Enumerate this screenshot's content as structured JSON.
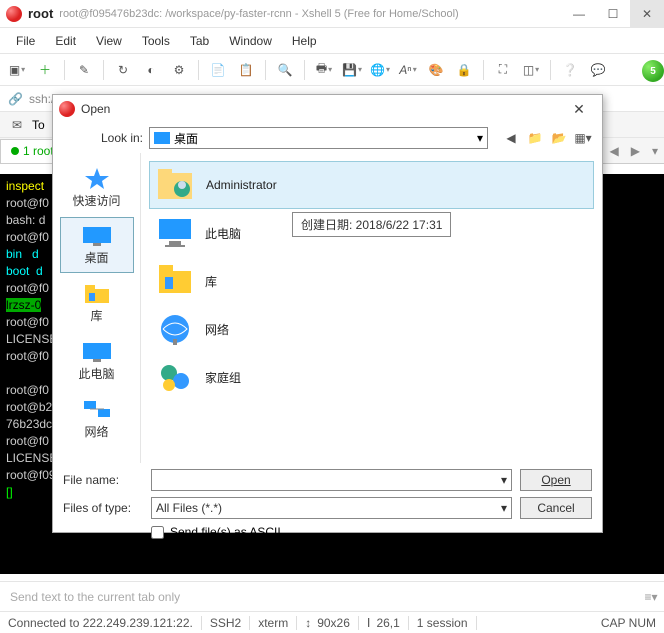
{
  "app": {
    "title": "root",
    "subtitle": "root@f095476b23dc: /workspace/py-faster-rcnn - Xshell 5 (Free for Home/School)"
  },
  "menus": [
    "File",
    "Edit",
    "View",
    "Tools",
    "Tab",
    "Window",
    "Help"
  ],
  "address": "ssh://root:**********@222.249.239.121:22",
  "tabs_to_label": "To",
  "tab1": {
    "label": "1 root"
  },
  "terminal_lines": [
    "inspect",
    "root@f0",
    "bash: d",
    "root@f0",
    "bin   d",
    "boot  d",
    "root@f0",
    "lrzsz-0",
    "root@f0",
    "LICENSE",
    "root@f0",
    "",
    "root@f0",
    "root@b2",
    "76b23dc",
    "root@f0",
    "LICENSE",
    "root@f095476b23dc:/workspace/py-faster-rcnn# rz",
    "[]"
  ],
  "terminal_extra": "0954",
  "input_placeholder": "Send text to the current tab only",
  "status": {
    "connected": "Connected to 222.249.239.121:22.",
    "proto": "SSH2",
    "term": "xterm",
    "size": "90x26",
    "pos": "26,1",
    "sess": "1 session",
    "caps": "CAP  NUM"
  },
  "opendlg": {
    "title": "Open",
    "lookin_label": "Look in:",
    "lookin_value": "桌面",
    "places": [
      {
        "label": "快速访问"
      },
      {
        "label": "桌面",
        "sel": true
      },
      {
        "label": "库"
      },
      {
        "label": "此电脑"
      },
      {
        "label": "网络"
      }
    ],
    "items": [
      {
        "name": "Administrator",
        "sel": true,
        "kind": "user"
      },
      {
        "name": "此电脑",
        "kind": "pc"
      },
      {
        "name": "库",
        "kind": "lib"
      },
      {
        "name": "网络",
        "kind": "net"
      },
      {
        "name": "家庭组",
        "kind": "home"
      }
    ],
    "tooltip": "创建日期: 2018/6/22 17:31",
    "filename_label": "File name:",
    "filename_value": "",
    "filetype_label": "Files of type:",
    "filetype_value": "All Files (*.*)",
    "send_ascii": "Send file(s) as ASCII",
    "open_btn": "Open",
    "cancel_btn": "Cancel"
  }
}
